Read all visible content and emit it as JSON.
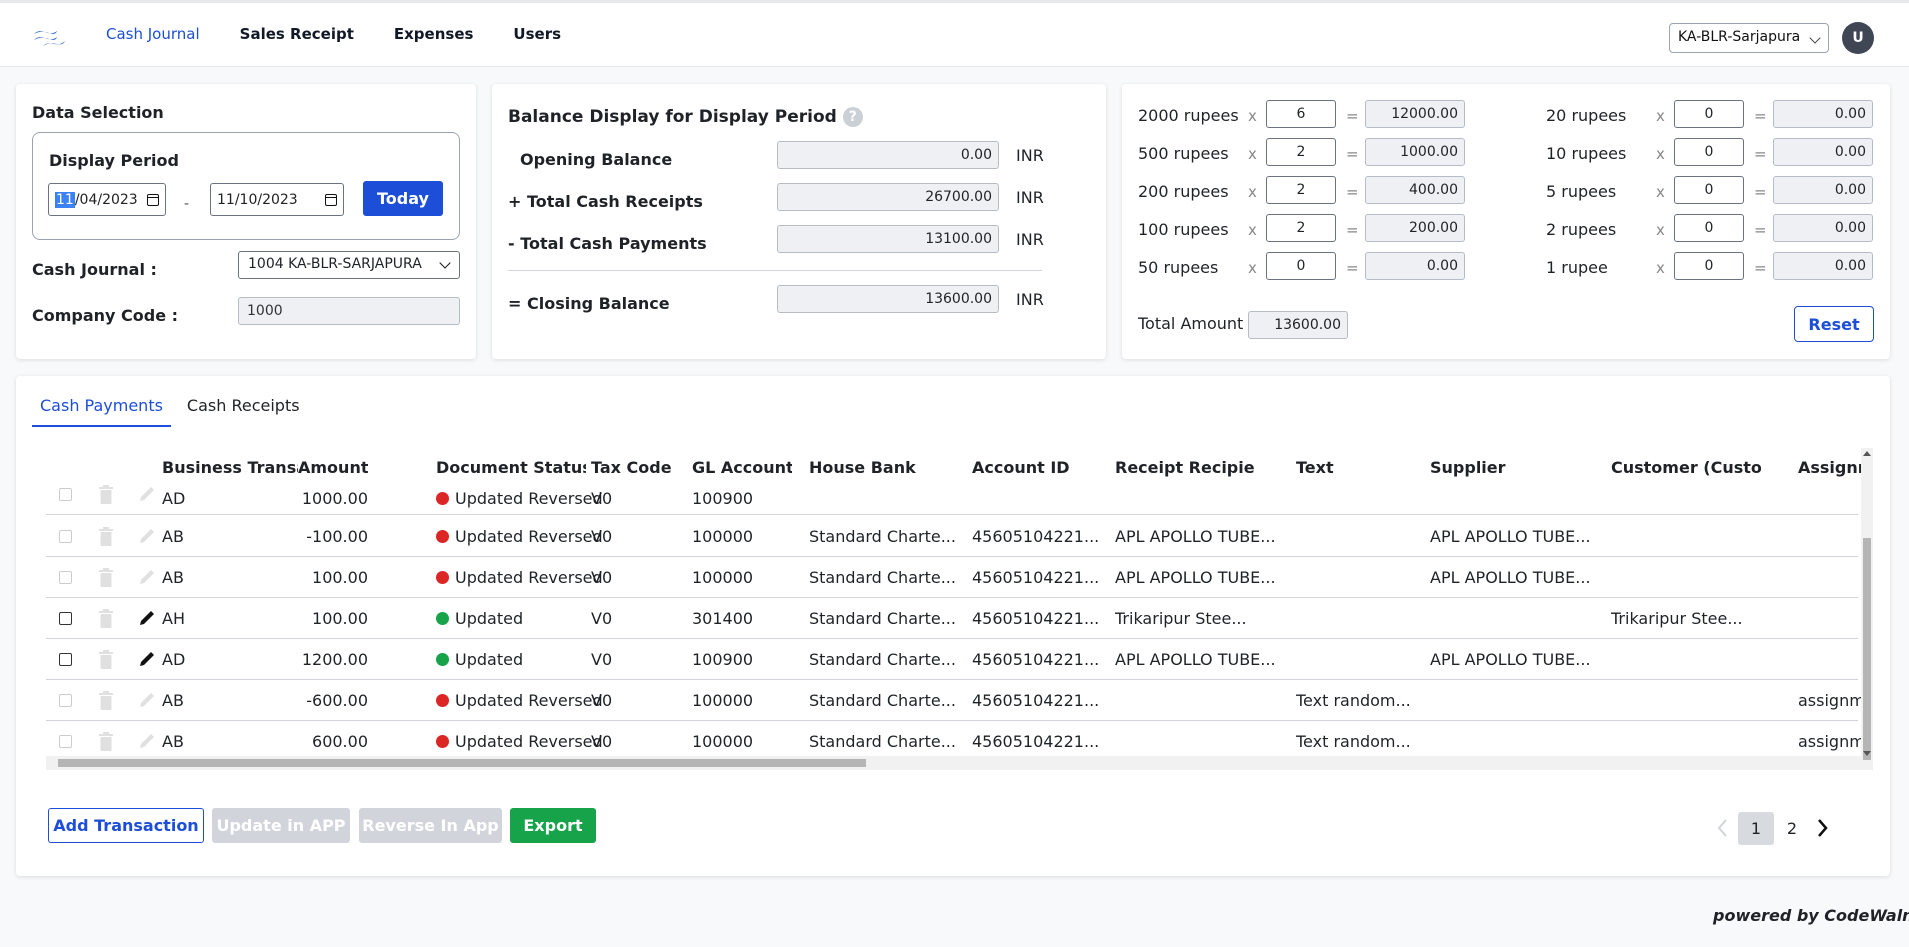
{
  "nav": {
    "items": [
      "Cash Journal",
      "Sales Receipt",
      "Expenses",
      "Users"
    ],
    "active_index": 0,
    "plant": "KA-BLR-Sarjapura",
    "avatar_initial": "U"
  },
  "data_selection": {
    "title": "Data Selection",
    "period_label": "Display Period",
    "date_from_hl": "11",
    "date_from_rest": "/04/2023",
    "date_to": "11/10/2023",
    "dash": "-",
    "today_button": "Today",
    "cash_journal_label": "Cash Journal :",
    "cash_journal_value": "1004 KA-BLR-SARJAPURA",
    "company_code_label": "Company Code :",
    "company_code_value": "1000"
  },
  "balance": {
    "title": "Balance Display for Display Period",
    "help": "?",
    "rows": [
      {
        "label": "Opening Balance",
        "value": "0.00",
        "currency": "INR"
      },
      {
        "label": "+ Total Cash Receipts",
        "value": "26700.00",
        "currency": "INR"
      },
      {
        "label": "- Total Cash Payments",
        "value": "13100.00",
        "currency": "INR"
      },
      {
        "label": "= Closing Balance",
        "value": "13600.00",
        "currency": "INR"
      }
    ]
  },
  "denominations": {
    "times": "x",
    "equals": "=",
    "left": [
      {
        "label": "2000 rupees",
        "qty": "6",
        "amount": "12000.00"
      },
      {
        "label": "500 rupees",
        "qty": "2",
        "amount": "1000.00"
      },
      {
        "label": "200 rupees",
        "qty": "2",
        "amount": "400.00"
      },
      {
        "label": "100 rupees",
        "qty": "2",
        "amount": "200.00"
      },
      {
        "label": "50 rupees",
        "qty": "0",
        "amount": "0.00"
      }
    ],
    "right": [
      {
        "label": "20 rupees",
        "qty": "0",
        "amount": "0.00"
      },
      {
        "label": "10 rupees",
        "qty": "0",
        "amount": "0.00"
      },
      {
        "label": "5 rupees",
        "qty": "0",
        "amount": "0.00"
      },
      {
        "label": "2 rupees",
        "qty": "0",
        "amount": "0.00"
      },
      {
        "label": "1 rupee",
        "qty": "0",
        "amount": "0.00"
      }
    ],
    "total_label": "Total Amount :",
    "total_value": "13600.00",
    "reset_button": "Reset"
  },
  "tabs": [
    "Cash Payments",
    "Cash Receipts"
  ],
  "table": {
    "headers": [
      "Business Transa...",
      "Amount",
      "Document Status",
      "Tax Code",
      "GL Account",
      "House Bank",
      "Account ID",
      "Receipt Recipie...",
      "Text",
      "Supplier",
      "Customer (Custo...",
      "Assignm"
    ],
    "rows": [
      {
        "bt": "AD",
        "amount": "1000.00",
        "status": "Updated Reversed",
        "tax": "V0",
        "gl": "100900",
        "bank": "",
        "account": "",
        "recipient": "",
        "text": "",
        "supplier": "",
        "customer": "",
        "assign": ""
      },
      {
        "bt": "AB",
        "amount": "-100.00",
        "status": "Updated Reversed",
        "tax": "V0",
        "gl": "100000",
        "bank": "Standard Charte...",
        "account": "45605104221...",
        "recipient": "APL APOLLO TUBE...",
        "text": "",
        "supplier": "APL APOLLO TUBE...",
        "customer": "",
        "assign": ""
      },
      {
        "bt": "AB",
        "amount": "100.00",
        "status": "Updated Reversed",
        "tax": "V0",
        "gl": "100000",
        "bank": "Standard Charte...",
        "account": "45605104221...",
        "recipient": "APL APOLLO TUBE...",
        "text": "",
        "supplier": "APL APOLLO TUBE...",
        "customer": "",
        "assign": ""
      },
      {
        "bt": "AH",
        "amount": "100.00",
        "status": "Updated",
        "tax": "V0",
        "gl": "301400",
        "bank": "Standard Charte...",
        "account": "45605104221...",
        "recipient": "Trikaripur Stee...",
        "text": "",
        "supplier": "",
        "customer": "Trikaripur Stee...",
        "assign": ""
      },
      {
        "bt": "AD",
        "amount": "1200.00",
        "status": "Updated",
        "tax": "V0",
        "gl": "100900",
        "bank": "Standard Charte...",
        "account": "45605104221...",
        "recipient": "APL APOLLO TUBE...",
        "text": "",
        "supplier": "APL APOLLO TUBE...",
        "customer": "",
        "assign": ""
      },
      {
        "bt": "AB",
        "amount": "-600.00",
        "status": "Updated Reversed",
        "tax": "V0",
        "gl": "100000",
        "bank": "Standard Charte...",
        "account": "45605104221...",
        "recipient": "",
        "text": "Text random...",
        "supplier": "",
        "customer": "",
        "assign": "assignm"
      },
      {
        "bt": "AB",
        "amount": "600.00",
        "status": "Updated Reversed",
        "tax": "V0",
        "gl": "100000",
        "bank": "Standard Charte...",
        "account": "45605104221...",
        "recipient": "",
        "text": "Text random...",
        "supplier": "",
        "customer": "",
        "assign": "assignm"
      }
    ]
  },
  "buttons": {
    "add": "Add Transaction",
    "update": "Update in APP",
    "reverse": "Reverse In App",
    "export": "Export"
  },
  "pager": {
    "pages": [
      "1",
      "2"
    ],
    "active": "1"
  },
  "footer": "powered by CodeWalnut",
  "colors": {
    "accent": "#1d4ed8",
    "status_red": "#dc2626",
    "status_green": "#16a34a",
    "export_green": "#16a34a"
  }
}
